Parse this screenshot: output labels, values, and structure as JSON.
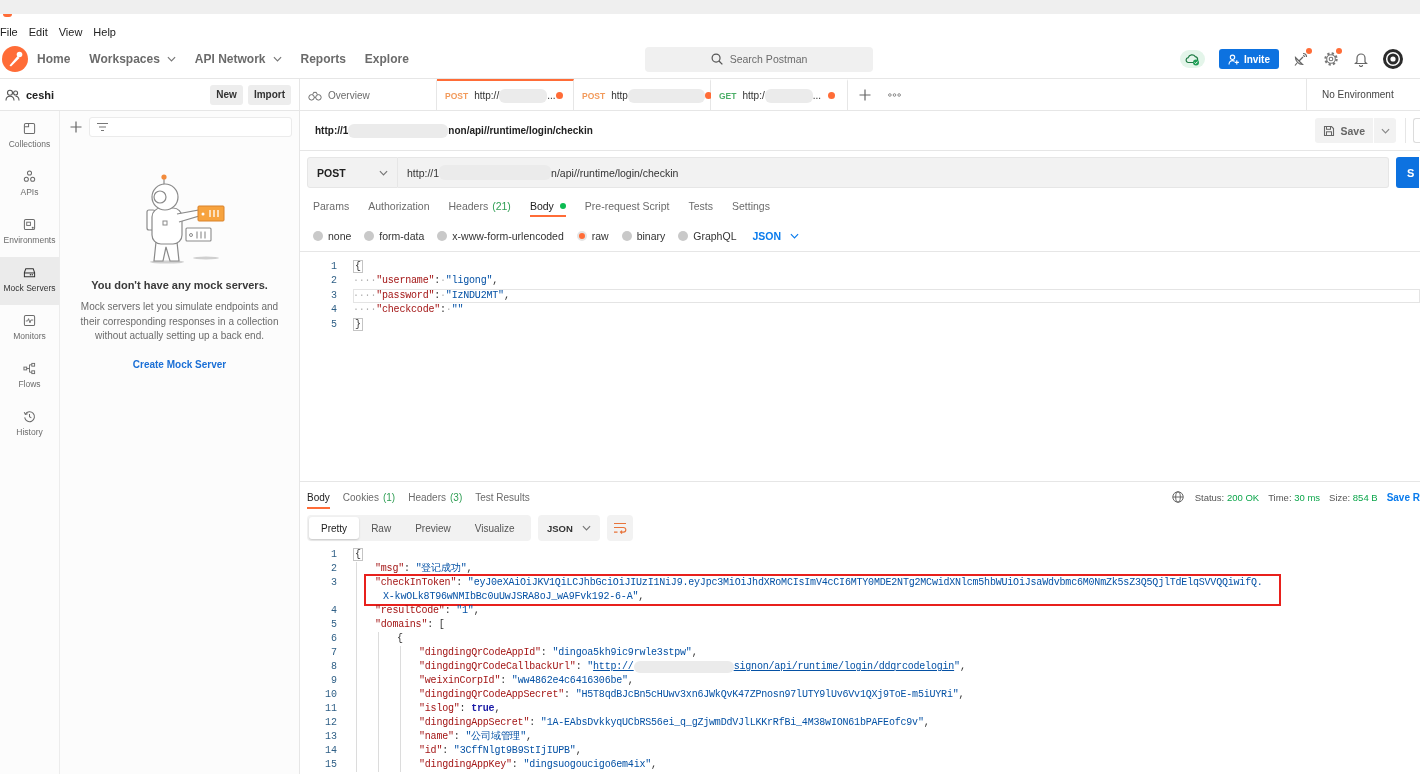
{
  "menu_bar": [
    "File",
    "Edit",
    "View",
    "Help"
  ],
  "header": {
    "nav": [
      {
        "label": "Home",
        "has_menu": false
      },
      {
        "label": "Workspaces",
        "has_menu": true
      },
      {
        "label": "API Network",
        "has_menu": true
      },
      {
        "label": "Reports",
        "has_menu": false
      },
      {
        "label": "Explore",
        "has_menu": false
      }
    ],
    "search": {
      "placeholder": "Search Postman"
    },
    "invite_button": "Invite",
    "icons": [
      {
        "notification": true
      },
      {
        "notification": true
      },
      {
        "notification": false
      }
    ]
  },
  "workspace": {
    "name": "ceshi",
    "buttons": [
      "New",
      "Import"
    ]
  },
  "sidebar": {
    "items": [
      {
        "label": "Collections",
        "selected": false
      },
      {
        "label": "APIs",
        "selected": false
      },
      {
        "label": "Environments",
        "selected": false
      },
      {
        "label": "Mock Servers",
        "selected": true
      },
      {
        "label": "Monitors",
        "selected": false
      },
      {
        "label": "Flows",
        "selected": false
      },
      {
        "label": "History",
        "selected": false
      }
    ]
  },
  "mock_panel": {
    "title": "You don't have any mock servers.",
    "description": "Mock servers let you simulate endpoints and their corresponding responses in a collection without actually setting up a back end.",
    "link": "Create Mock Server"
  },
  "tabs": [
    {
      "kind": "overview",
      "label": "Overview",
      "selected": false
    },
    {
      "kind": "request",
      "method": "POST",
      "color": "#f29a5b",
      "url_start": "http://",
      "url_end": "...",
      "unsaved": true,
      "selected": true
    },
    {
      "kind": "request",
      "method": "POST",
      "color": "#f29a5b",
      "url_start": "http",
      "unsaved": true,
      "selected": false
    },
    {
      "kind": "request",
      "method": "GET",
      "color": "#4caf68",
      "url_start": "http:/",
      "url_end": "...",
      "unsaved": true,
      "selected": false
    }
  ],
  "environment": "No Environment",
  "request": {
    "title_parts": [
      {
        "kind": "text",
        "text": "http://1"
      },
      {
        "kind": "redacted"
      },
      {
        "kind": "text",
        "text": "non/api//runtime/login/checkin"
      }
    ],
    "save_button": "Save",
    "method": "POST",
    "url_parts": [
      {
        "kind": "text",
        "text": "http://1"
      },
      {
        "kind": "redacted"
      },
      {
        "kind": "text",
        "text": "n/api//runtime/login/checkin"
      }
    ],
    "send_button": "S",
    "tabs": [
      {
        "label": "Params",
        "selected": false
      },
      {
        "label": "Authorization",
        "selected": false
      },
      {
        "label": "Headers",
        "count": "(21)",
        "selected": false
      },
      {
        "label": "Body",
        "has_content": true,
        "selected": true
      },
      {
        "label": "Pre-request Script",
        "selected": false
      },
      {
        "label": "Tests",
        "selected": false
      },
      {
        "label": "Settings",
        "selected": false
      }
    ],
    "body_types": [
      {
        "label": "none",
        "selected": false
      },
      {
        "label": "form-data",
        "selected": false
      },
      {
        "label": "x-www-form-urlencoded",
        "selected": false
      },
      {
        "label": "raw",
        "selected": true
      },
      {
        "label": "binary",
        "selected": false
      },
      {
        "label": "GraphQL",
        "selected": false
      }
    ],
    "language": "JSON",
    "body_lines": [
      {
        "number": "1",
        "current": false,
        "tokens": [
          {
            "kind": "bracket",
            "text": "{"
          }
        ]
      },
      {
        "number": "2",
        "current": false,
        "tokens": [
          {
            "kind": "ws",
            "text": "····"
          },
          {
            "kind": "key",
            "text": "\"username\""
          },
          {
            "kind": "punct",
            "text": ":"
          },
          {
            "kind": "ws",
            "text": "·"
          },
          {
            "kind": "string",
            "text": "\"ligong\""
          },
          {
            "kind": "punct",
            "text": ","
          }
        ]
      },
      {
        "number": "3",
        "current": true,
        "tokens": [
          {
            "kind": "ws",
            "text": "····"
          },
          {
            "kind": "key",
            "text": "\"password\""
          },
          {
            "kind": "punct",
            "text": ":"
          },
          {
            "kind": "ws",
            "text": "·"
          },
          {
            "kind": "string",
            "text": "\"IzNDU2MT\""
          },
          {
            "kind": "punct",
            "text": ","
          }
        ]
      },
      {
        "number": "4",
        "current": false,
        "tokens": [
          {
            "kind": "ws",
            "text": "····"
          },
          {
            "kind": "key",
            "text": "\"checkcode\""
          },
          {
            "kind": "punct",
            "text": ":"
          },
          {
            "kind": "ws",
            "text": "·"
          },
          {
            "kind": "string",
            "text": "\"\""
          }
        ]
      },
      {
        "number": "5",
        "current": false,
        "tokens": [
          {
            "kind": "bracket",
            "text": "}"
          }
        ]
      }
    ]
  },
  "response": {
    "tabs": [
      {
        "label": "Body",
        "selected": true
      },
      {
        "label": "Cookies",
        "count": "(1)",
        "selected": false
      },
      {
        "label": "Headers",
        "count": "(3)",
        "selected": false
      },
      {
        "label": "Test Results",
        "selected": false
      }
    ],
    "status": [
      {
        "label": "Status:",
        "value": "200 OK"
      },
      {
        "label": "Time:",
        "value": "30 ms"
      },
      {
        "label": "Size:",
        "value": "854 B"
      }
    ],
    "save_link": "Save R",
    "views": [
      {
        "label": "Pretty",
        "selected": true
      },
      {
        "label": "Raw",
        "selected": false
      },
      {
        "label": "Preview",
        "selected": false
      },
      {
        "label": "Visualize",
        "selected": false
      }
    ],
    "format": "JSON",
    "lines": [
      {
        "number": "1",
        "tokens": [
          {
            "kind": "bracket",
            "text": "{"
          }
        ],
        "children": [
          {
            "number": "2",
            "tokens": [
              {
                "kind": "key",
                "text": "\"msg\""
              },
              {
                "kind": "punct",
                "text": ": "
              },
              {
                "kind": "string",
                "text": "\"登记成功\""
              },
              {
                "kind": "punct",
                "text": ","
              }
            ]
          },
          {
            "number": "3",
            "outlined": true,
            "tokens": [
              {
                "kind": "key",
                "text": "\"checkInToken\""
              },
              {
                "kind": "punct",
                "text": ": "
              },
              {
                "kind": "string",
                "text": "\"eyJ0eXAiOiJKV1QiLCJhbGciOiJIUzI1NiJ9.eyJpc3MiOiJhdXRoMCIsImV4cCI6MTY0MDE2NTg2MCwidXNlcm5hbWUiOiJsaWdvbmc6M0NmZk5sZ3Q5QjlTdElqSVVQQiwifQ."
              }
            ],
            "wrap": [
              {
                "kind": "string",
                "text": "X-kwOLk8T96wNMIbBc0uUwJSRA8oJ_wA9Fvk192-6-A\""
              },
              {
                "kind": "punct",
                "text": ","
              }
            ]
          },
          {
            "number": "4",
            "tokens": [
              {
                "kind": "key",
                "text": "\"resultCode\""
              },
              {
                "kind": "punct",
                "text": ": "
              },
              {
                "kind": "string",
                "text": "\"1\""
              },
              {
                "kind": "punct",
                "text": ","
              }
            ]
          },
          {
            "number": "5",
            "tokens": [
              {
                "kind": "key",
                "text": "\"domains\""
              },
              {
                "kind": "punct",
                "text": ": ["
              }
            ],
            "children": [
              {
                "number": "6",
                "tokens": [
                  {
                    "kind": "punct",
                    "text": "{"
                  }
                ],
                "children": [
                  {
                    "number": "7",
                    "tokens": [
                      {
                        "kind": "key",
                        "text": "\"dingdingQrCodeAppId\""
                      },
                      {
                        "kind": "punct",
                        "text": ": "
                      },
                      {
                        "kind": "string",
                        "text": "\"dingoa5kh9ic9rwle3stpw\""
                      },
                      {
                        "kind": "punct",
                        "text": ","
                      }
                    ]
                  },
                  {
                    "number": "8",
                    "tokens": [
                      {
                        "kind": "key",
                        "text": "\"dingdingQrCodeCallbackUrl\""
                      },
                      {
                        "kind": "punct",
                        "text": ": "
                      },
                      {
                        "kind": "string",
                        "text": "\""
                      },
                      {
                        "kind": "link",
                        "text": "http://"
                      },
                      {
                        "kind": "redacted"
                      },
                      {
                        "kind": "link",
                        "text": "signon/api/runtime/login/ddqrcodelogin"
                      },
                      {
                        "kind": "string",
                        "text": "\""
                      },
                      {
                        "kind": "punct",
                        "text": ","
                      }
                    ]
                  },
                  {
                    "number": "9",
                    "tokens": [
                      {
                        "kind": "key",
                        "text": "\"weixinCorpId\""
                      },
                      {
                        "kind": "punct",
                        "text": ": "
                      },
                      {
                        "kind": "string",
                        "text": "\"ww4862e4c6416306be\""
                      },
                      {
                        "kind": "punct",
                        "text": ","
                      }
                    ]
                  },
                  {
                    "number": "10",
                    "tokens": [
                      {
                        "kind": "key",
                        "text": "\"dingdingQrCodeAppSecret\""
                      },
                      {
                        "kind": "punct",
                        "text": ": "
                      },
                      {
                        "kind": "string",
                        "text": "\"H5T8qdBJcBn5cHUwv3xn6JWkQvK47ZPnosn97lUTY9lUv6Vv1QXj9ToE-m5iUYRi\""
                      },
                      {
                        "kind": "punct",
                        "text": ","
                      }
                    ]
                  },
                  {
                    "number": "11",
                    "tokens": [
                      {
                        "kind": "key",
                        "text": "\"islog\""
                      },
                      {
                        "kind": "punct",
                        "text": ": "
                      },
                      {
                        "kind": "bool",
                        "text": "true"
                      },
                      {
                        "kind": "punct",
                        "text": ","
                      }
                    ]
                  },
                  {
                    "number": "12",
                    "tokens": [
                      {
                        "kind": "key",
                        "text": "\"dingdingAppSecret\""
                      },
                      {
                        "kind": "punct",
                        "text": ": "
                      },
                      {
                        "kind": "string",
                        "text": "\"1A-EAbsDvkkyqUCbRS56ei_q_gZjwmDdVJlLKKrRfBi_4M38wION61bPAFEofc9v\""
                      },
                      {
                        "kind": "punct",
                        "text": ","
                      }
                    ]
                  },
                  {
                    "number": "13",
                    "tokens": [
                      {
                        "kind": "key",
                        "text": "\"name\""
                      },
                      {
                        "kind": "punct",
                        "text": ": "
                      },
                      {
                        "kind": "string",
                        "text": "\"公司域管理\""
                      },
                      {
                        "kind": "punct",
                        "text": ","
                      }
                    ]
                  },
                  {
                    "number": "14",
                    "tokens": [
                      {
                        "kind": "key",
                        "text": "\"id\""
                      },
                      {
                        "kind": "punct",
                        "text": ": "
                      },
                      {
                        "kind": "string",
                        "text": "\"3CffNlgt9B9StIjIUPB\""
                      },
                      {
                        "kind": "punct",
                        "text": ","
                      }
                    ]
                  },
                  {
                    "number": "15",
                    "tokens": [
                      {
                        "kind": "key",
                        "text": "\"dingdingAppKey\""
                      },
                      {
                        "kind": "punct",
                        "text": ": "
                      },
                      {
                        "kind": "string",
                        "text": "\"dingsuogoucigo6em4ix\""
                      },
                      {
                        "kind": "punct",
                        "text": ","
                      }
                    ]
                  }
                ]
              }
            ]
          }
        ]
      }
    ]
  }
}
